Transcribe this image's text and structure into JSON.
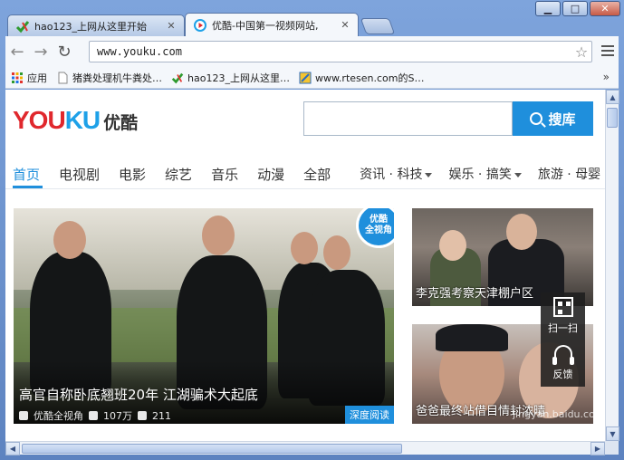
{
  "window": {
    "controls": {
      "minimize": "▁",
      "maximize": "□",
      "close": "✕"
    }
  },
  "tabs": [
    {
      "title": "hao123_上网从这里开始",
      "icon": "hao123-icon"
    },
    {
      "title": "优酷-中国第一视频网站,",
      "icon": "youku-icon",
      "active": true
    }
  ],
  "toolbar": {
    "url": "www.youku.com"
  },
  "bookmarks": [
    {
      "label": "应用",
      "icon": "apps-grid-icon"
    },
    {
      "label": "猪粪处理机牛粪处…",
      "icon": "page-icon"
    },
    {
      "label": "hao123_上网从这里…",
      "icon": "hao123-icon"
    },
    {
      "label": "www.rtesen.com的S…",
      "icon": "site-icon"
    }
  ],
  "bookmarks_more": "»",
  "youku": {
    "logo_you": "YOU",
    "logo_ku": "KU",
    "logo_cn": "优酷",
    "search_placeholder": "",
    "search_button": "搜库",
    "nav": [
      {
        "label": "首页",
        "active": true
      },
      {
        "label": "电视剧"
      },
      {
        "label": "电影"
      },
      {
        "label": "综艺"
      },
      {
        "label": "音乐"
      },
      {
        "label": "动漫"
      },
      {
        "label": "全部"
      },
      {
        "label": "资讯 · 科技",
        "dropdown": true
      },
      {
        "label": "娱乐 · 搞笑",
        "dropdown": true
      },
      {
        "label": "旅游 · 母婴"
      }
    ],
    "hero": {
      "caption": "高官自称卧底翘班20年 江湖骗术大起底",
      "channel": "优酷全视角",
      "views": "107万",
      "comments": "211",
      "tag": "深度阅读",
      "badge_line1": "优酷",
      "badge_line2": "全视角"
    },
    "cards": [
      {
        "caption": "李克强考察天津棚户区"
      },
      {
        "caption": "爸爸最终站借目情封浓晴"
      }
    ],
    "tools": [
      {
        "label": "扫一扫",
        "icon": "qr-code-icon"
      },
      {
        "label": "反馈",
        "icon": "headset-icon"
      }
    ]
  },
  "watermark": "jingyan.baidu.com",
  "colors": {
    "accent": "#1f8fdc",
    "logo_red": "#e0282d",
    "logo_blue": "#1ea1e8"
  }
}
